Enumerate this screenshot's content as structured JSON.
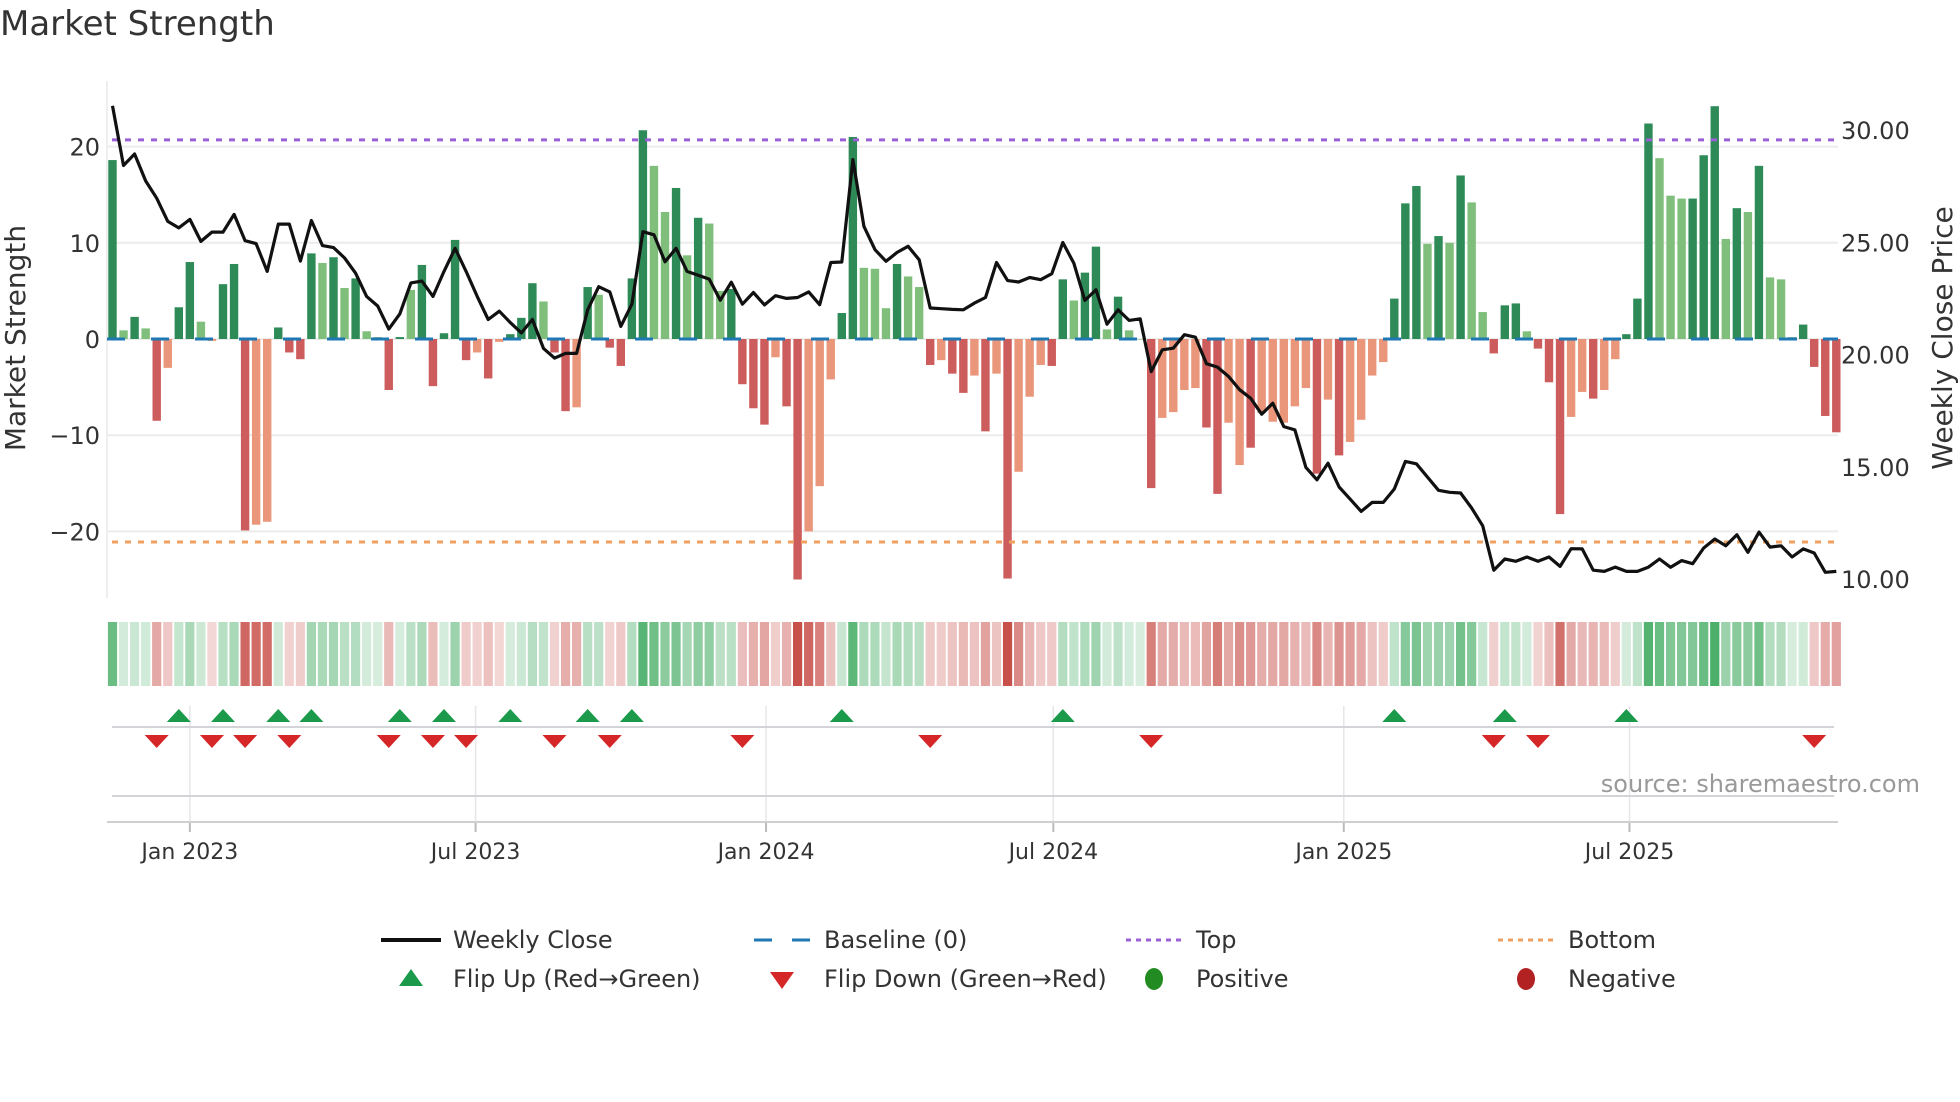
{
  "title": "Market Strength",
  "source": "source: sharemaestro.com",
  "chart_data": {
    "type": "bar+line",
    "title": "Market Strength",
    "ylabel": "Market Strength",
    "y2label": "Weekly Close Price",
    "ylim": [
      -27,
      27
    ],
    "y2lim": [
      9.15,
      32.2
    ],
    "yticks": [
      20,
      10,
      0,
      -10,
      -20
    ],
    "ytick_labels": [
      "20",
      "10",
      "0",
      "−10",
      "−20"
    ],
    "y2ticks": [
      30,
      25,
      20,
      15,
      10
    ],
    "y2tick_labels": [
      "30.00",
      "25.00",
      "20.00",
      "15.00",
      "10.00"
    ],
    "first_week": "2022-11-13",
    "xticks": [
      {
        "date": "2023-01-01",
        "label": "Jan 2023"
      },
      {
        "date": "2023-07-01",
        "label": "Jul 2023"
      },
      {
        "date": "2024-01-01",
        "label": "Jan 2024"
      },
      {
        "date": "2024-07-01",
        "label": "Jul 2024"
      },
      {
        "date": "2025-01-01",
        "label": "Jan 2025"
      },
      {
        "date": "2025-07-01",
        "label": "Jul 2025"
      }
    ],
    "top_level": 20.7,
    "bottom_level": -21.1,
    "baseline": 0,
    "strength": [
      18.6,
      0.9,
      2.3,
      1.1,
      -8.5,
      -3,
      3.3,
      8,
      1.8,
      -0.2,
      5.7,
      7.8,
      -19.9,
      -19.3,
      -19,
      1.2,
      -1.4,
      -2.1,
      8.9,
      7.9,
      8.5,
      5.3,
      6.3,
      0.8,
      0.2,
      -5.3,
      0.2,
      5.1,
      7.7,
      -4.9,
      0.6,
      10.3,
      -2.2,
      -1.4,
      -4.1,
      -0.3,
      0.5,
      2.2,
      5.8,
      3.9,
      -1.4,
      -7.5,
      -7.1,
      5.4,
      4.6,
      -0.9,
      -2.8,
      6.3,
      21.7,
      18,
      13.2,
      15.7,
      8.7,
      12.6,
      12,
      5,
      5.2,
      -4.7,
      -7.2,
      -8.9,
      -1.9,
      -7,
      -25,
      -20,
      -15.3,
      -4.2,
      2.7,
      21,
      7.4,
      7.3,
      3.2,
      7.8,
      6.5,
      5.4,
      -2.7,
      -2.2,
      -3.6,
      -5.6,
      -3.8,
      -9.6,
      -3.6,
      -24.9,
      -13.8,
      -6,
      -2.7,
      -2.8,
      6.2,
      4,
      6.9,
      9.6,
      1,
      4.4,
      0.9,
      0,
      -15.5,
      -8.2,
      -7.6,
      -5.3,
      -5.1,
      -9.2,
      -16.1,
      -8.7,
      -13.1,
      -11.3,
      -7.7,
      -8.6,
      -8.7,
      -7,
      -5.1,
      -14,
      -6.3,
      -12.1,
      -10.7,
      -8.4,
      -3.8,
      -2.4,
      4.2,
      14.1,
      15.9,
      9.9,
      10.7,
      10,
      17,
      14.2,
      2.8,
      -1.5,
      3.5,
      3.7,
      0.8,
      -1,
      -4.5,
      -18.2,
      -8.1,
      -5.5,
      -6.2,
      -5.3,
      -2.1,
      0.5,
      4.2,
      22.4,
      18.8,
      14.9,
      14.6,
      14.6,
      19.1,
      24.2,
      10.4,
      13.6,
      13.2,
      18,
      6.4,
      6.2,
      0.2,
      1.5,
      -2.9,
      -8,
      -9.7
    ],
    "bar_class": "GgGgRrGGgrGGRrrGRRGgGgGggRGgGRGGRrRrGGGgRRrGgRRGGggGgGggGRRRrRRrrrGGgggGggRrRRrRrRrrrRGgGGgGggRrrrrRRrrRrrrrrRrRrrrrGGGgGgGggRGGgRRRrrRrrGGGgggGGGgGgGgggGRRR",
    "bar_class_legend": {
      "G": "strong positive",
      "g": "weak positive",
      "R": "strong negative",
      "r": "weak negative"
    },
    "weekly_close": [
      31.08,
      28.42,
      28.93,
      27.73,
      26.96,
      25.93,
      25.64,
      26.02,
      25.04,
      25.45,
      25.45,
      26.24,
      25.07,
      24.94,
      23.7,
      25.81,
      25.81,
      24.16,
      25.97,
      24.85,
      24.76,
      24.3,
      23.62,
      22.59,
      22.16,
      21.13,
      21.81,
      23.19,
      23.27,
      22.59,
      23.7,
      24.73,
      23.7,
      22.59,
      21.56,
      21.93,
      21.42,
      20.96,
      21.56,
      20.27,
      19.84,
      20.05,
      20.05,
      21.99,
      23.02,
      22.79,
      21.25,
      22.24,
      25.47,
      25.33,
      24.13,
      24.73,
      23.7,
      23.53,
      23.36,
      22.42,
      23.22,
      22.24,
      22.76,
      22.21,
      22.62,
      22.5,
      22.54,
      22.79,
      22.22,
      24.1,
      24.12,
      28.68,
      25.71,
      24.67,
      24.15,
      24.55,
      24.82,
      24.22,
      22.07,
      22.04,
      22.01,
      21.99,
      22.29,
      22.54,
      24.1,
      23.29,
      23.23,
      23.43,
      23.33,
      23.6,
      24.99,
      24.07,
      22.41,
      22.88,
      21.35,
      21.99,
      21.52,
      21.59,
      19.24,
      20.21,
      20.28,
      20.88,
      20.77,
      19.59,
      19.44,
      19.02,
      18.43,
      18.05,
      17.34,
      17.83,
      16.79,
      16.64,
      14.97,
      14.42,
      15.16,
      14.1,
      13.56,
      13.01,
      13.41,
      13.41,
      14.01,
      15.24,
      15.13,
      14.54,
      13.95,
      13.86,
      13.83,
      13.16,
      12.37,
      10.39,
      10.89,
      10.79,
      10.98,
      10.79,
      10.98,
      10.56,
      11.35,
      11.34,
      10.39,
      10.34,
      10.53,
      10.34,
      10.34,
      10.53,
      10.89,
      10.52,
      10.82,
      10.68,
      11.38,
      11.78,
      11.48,
      11.97,
      11.19,
      12.09,
      11.42,
      11.48,
      10.98,
      11.34,
      11.16,
      10.3,
      10.34
    ],
    "flip_up_weeks": [
      6,
      10,
      15,
      18,
      26,
      30,
      36,
      43,
      47,
      66,
      86,
      116,
      126,
      137
    ],
    "flip_down_weeks": [
      4,
      9,
      12,
      16,
      25,
      29,
      32,
      40,
      45,
      57,
      74,
      94,
      125,
      129,
      154
    ],
    "colors": {
      "strong_pos": "#2e8b57",
      "weak_pos": "#7fbf7b",
      "strong_neg": "#cd5c5c",
      "weak_neg": "#e9967a",
      "line": "#111111",
      "baseline": "#1f77b4",
      "top": "#9b5fd6",
      "bottom": "#f0a060",
      "flip_up": "#1a9a4a",
      "flip_down": "#d62728",
      "positive": "#228b22",
      "negative": "#b22222",
      "strip_pos": "#4caf6a",
      "strip_neg": "#c8504a"
    },
    "legend": [
      {
        "key": "weekly_close",
        "label": "Weekly Close"
      },
      {
        "key": "baseline",
        "label": "Baseline (0)"
      },
      {
        "key": "top",
        "label": "Top"
      },
      {
        "key": "bottom",
        "label": "Bottom"
      },
      {
        "key": "flip_up",
        "label": "Flip Up (Red→Green)"
      },
      {
        "key": "flip_down",
        "label": "Flip Down (Green→Red)"
      },
      {
        "key": "positive",
        "label": "Positive"
      },
      {
        "key": "negative",
        "label": "Negative"
      }
    ],
    "legend_position": "bottom-center"
  }
}
